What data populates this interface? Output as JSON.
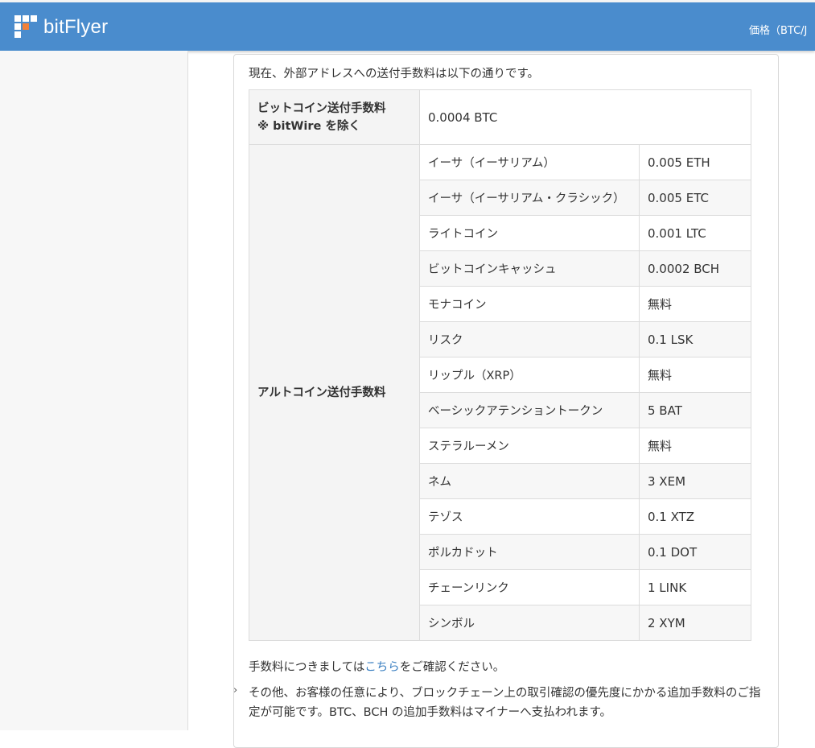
{
  "header": {
    "logo_text": "bitFlyer",
    "nav_text": "価格（BTC/J"
  },
  "main": {
    "intro_text": "現在、外部アドレスへの送付手数料は以下の通りです。",
    "btc_fee": {
      "label_line1": "ビットコイン送付手数料",
      "label_line2": "※ bitWire を除く",
      "value": "0.0004 BTC"
    },
    "altcoin_fee": {
      "label": "アルトコイン送付手数料",
      "rows": [
        {
          "coin": "イーサ（イーサリアム）",
          "fee": "0.005 ETH"
        },
        {
          "coin": "イーサ（イーサリアム・クラシック）",
          "fee": "0.005 ETC"
        },
        {
          "coin": "ライトコイン",
          "fee": "0.001 LTC"
        },
        {
          "coin": "ビットコインキャッシュ",
          "fee": "0.0002 BCH"
        },
        {
          "coin": "モナコイン",
          "fee": "無料"
        },
        {
          "coin": "リスク",
          "fee": "0.1 LSK"
        },
        {
          "coin": "リップル（XRP）",
          "fee": "無料"
        },
        {
          "coin": "ベーシックアテンショントークン",
          "fee": "5 BAT"
        },
        {
          "coin": "ステラルーメン",
          "fee": "無料"
        },
        {
          "coin": "ネム",
          "fee": "3 XEM"
        },
        {
          "coin": "テゾス",
          "fee": "0.1 XTZ"
        },
        {
          "coin": "ポルカドット",
          "fee": "0.1 DOT"
        },
        {
          "coin": "チェーンリンク",
          "fee": "1 LINK"
        },
        {
          "coin": "シンボル",
          "fee": "2 XYM"
        }
      ]
    },
    "note1_prefix": "手数料につきましては",
    "note1_link": "こちら",
    "note1_suffix": "をご確認ください。",
    "bullet": "›",
    "note2_text": "その他、お客様の任意により、ブロックチェーン上の取引確認の優先度にかかる追加手数料のご指定が可能です。BTC、BCH の追加手数料はマイナーへ支払われます。"
  },
  "colors": {
    "header_bg": "#4a8ccd",
    "logo_accent": "#f2813a",
    "link": "#3a7fc1"
  }
}
